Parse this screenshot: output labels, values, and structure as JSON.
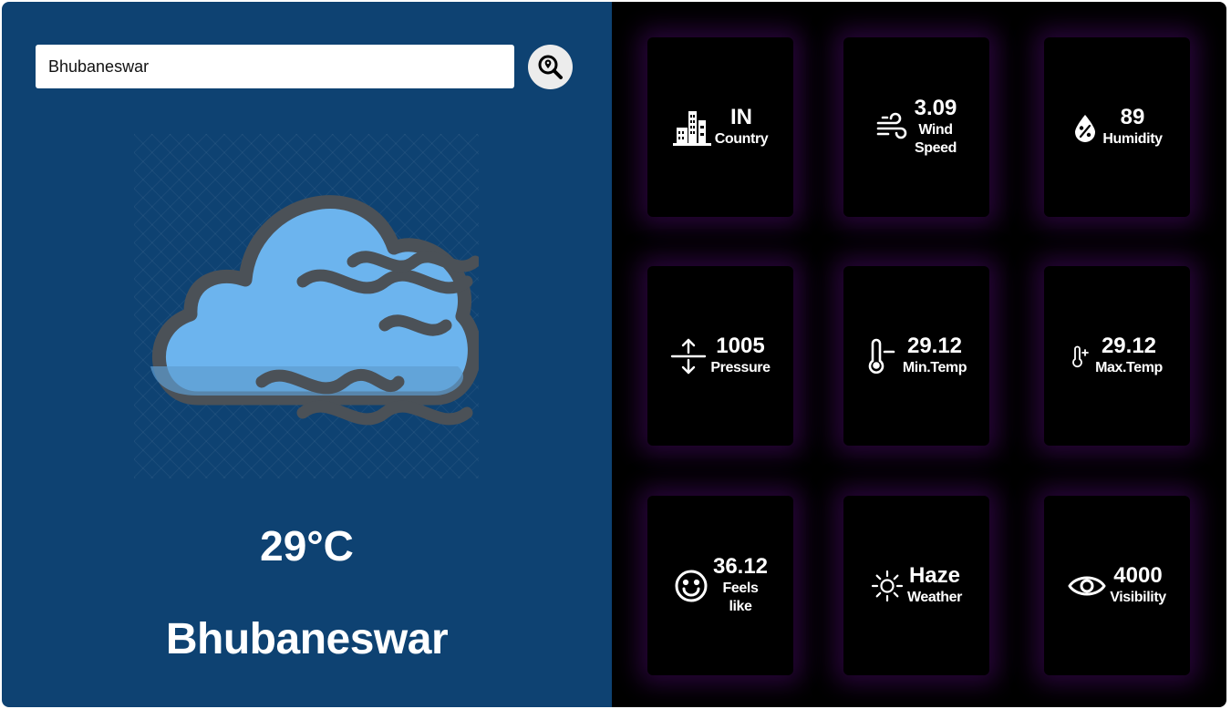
{
  "search": {
    "value": "Bhubaneswar",
    "button_icon": "search-location-icon"
  },
  "main": {
    "illustration": "cloud-wind-icon",
    "temperature": "29°C",
    "city": "Bhubaneswar"
  },
  "cards": [
    {
      "id": "country",
      "icon": "city-icon",
      "value": "IN",
      "label": "Country"
    },
    {
      "id": "wind",
      "icon": "wind-icon",
      "value": "3.09",
      "label": "Wind Speed"
    },
    {
      "id": "humidity",
      "icon": "humidity-icon",
      "value": "89",
      "label": "Humidity"
    },
    {
      "id": "pressure",
      "icon": "pressure-icon",
      "value": "1005",
      "label": "Pressure"
    },
    {
      "id": "min-temp",
      "icon": "thermometer-minus-icon",
      "value": "29.12",
      "label": "Min.Temp"
    },
    {
      "id": "max-temp",
      "icon": "thermometer-plus-icon",
      "value": "29.12",
      "label": "Max.Temp"
    },
    {
      "id": "feels-like",
      "icon": "smile-icon",
      "value": "36.12",
      "label": "Feels like"
    },
    {
      "id": "weather",
      "icon": "sun-icon",
      "value": "Haze",
      "label": "Weather"
    },
    {
      "id": "visibility",
      "icon": "eye-icon",
      "value": "4000",
      "label": "Visibility"
    }
  ],
  "colors": {
    "left_panel": "#0e4272",
    "right_panel": "#000000",
    "card_glow": "#460a64",
    "cloud": "#6cb4ee",
    "outline": "#4b5157"
  }
}
